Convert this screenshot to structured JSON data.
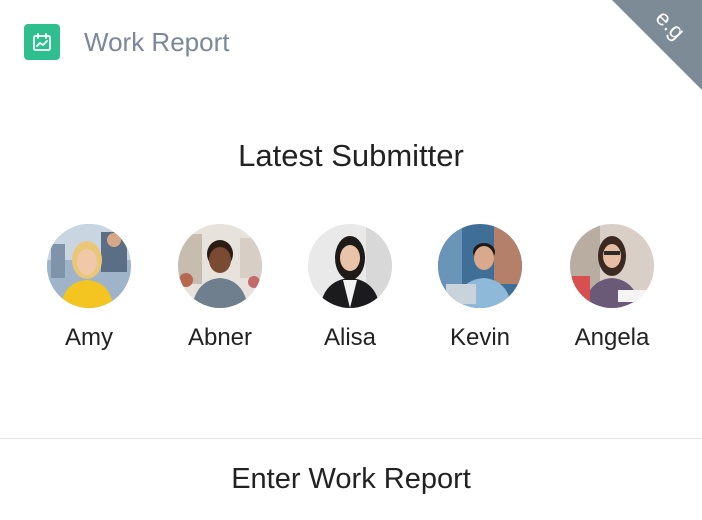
{
  "header": {
    "title": "Work Report",
    "icon": "calendar-chart-icon",
    "icon_color": "#2fbf8f",
    "corner_badge": "e.g"
  },
  "section": {
    "title": "Latest Submitter"
  },
  "people": [
    {
      "name": "Amy",
      "avatar": "avatar-photo"
    },
    {
      "name": "Abner",
      "avatar": "avatar-photo"
    },
    {
      "name": "Alisa",
      "avatar": "avatar-photo"
    },
    {
      "name": "Kevin",
      "avatar": "avatar-photo"
    },
    {
      "name": "Angela",
      "avatar": "avatar-photo"
    }
  ],
  "footer": {
    "button_label": "Enter Work Report"
  },
  "colors": {
    "accent": "#2fbf8f",
    "corner": "#7d8b96",
    "title_gray": "#7a8899"
  }
}
